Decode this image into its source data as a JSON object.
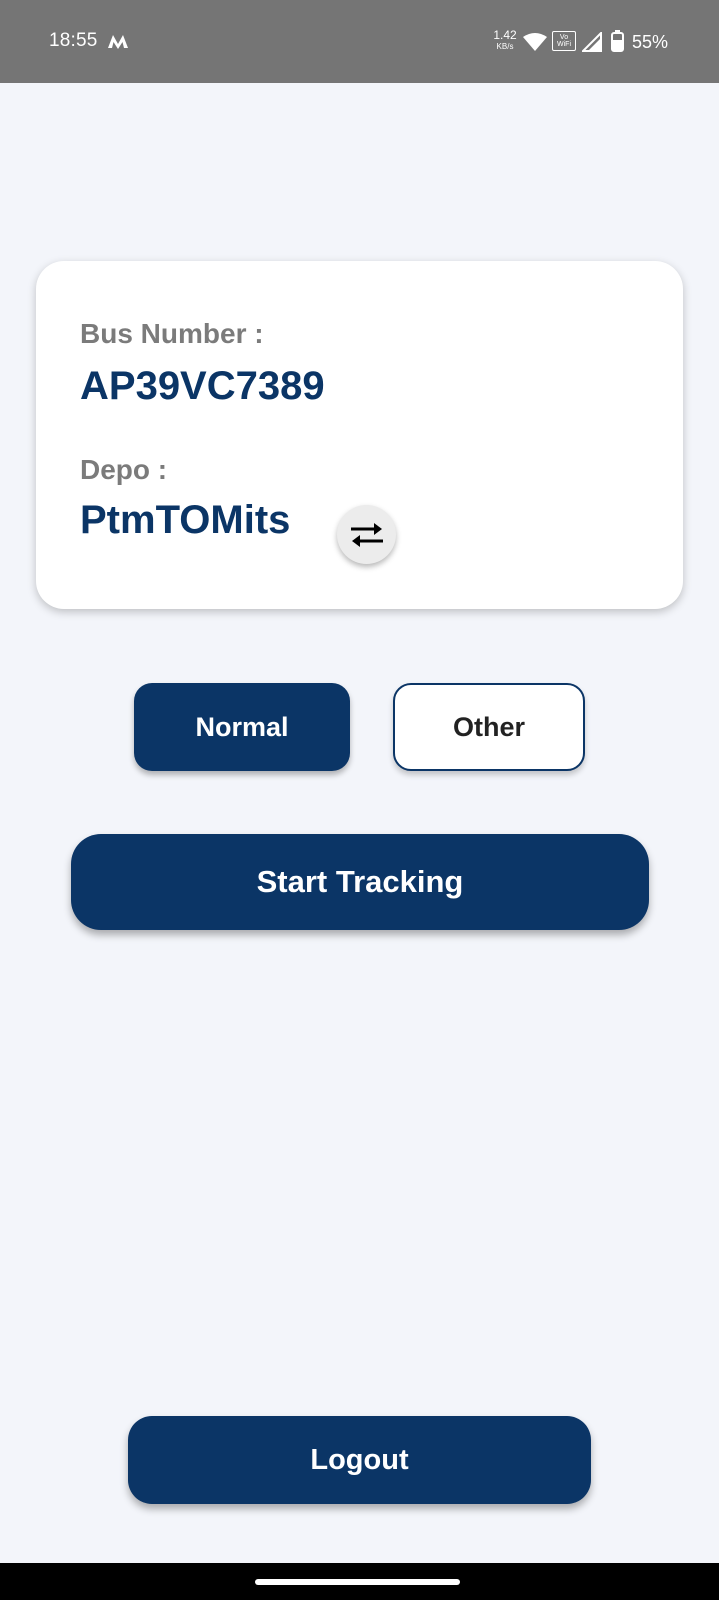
{
  "status_bar": {
    "time": "18:55",
    "app_icon": "m-notification-icon",
    "net_speed_value": "1.42",
    "net_speed_unit": "KB/s",
    "vowifi_line1": "Vo",
    "vowifi_line2": "WiFi",
    "battery_percent": "55%"
  },
  "card": {
    "bus_number_label": "Bus Number :",
    "bus_number_value": "AP39VC7389",
    "depo_label": "Depo :",
    "depo_value": "PtmTOMits",
    "swap_icon": "swap-arrows-icon"
  },
  "mode": {
    "normal_label": "Normal",
    "other_label": "Other",
    "selected": "Normal"
  },
  "actions": {
    "start_tracking_label": "Start Tracking",
    "logout_label": "Logout"
  },
  "colors": {
    "primary": "#0b3566",
    "background": "#f3f5fa",
    "status_bar": "#757575",
    "label_gray": "#7b7b7b"
  }
}
